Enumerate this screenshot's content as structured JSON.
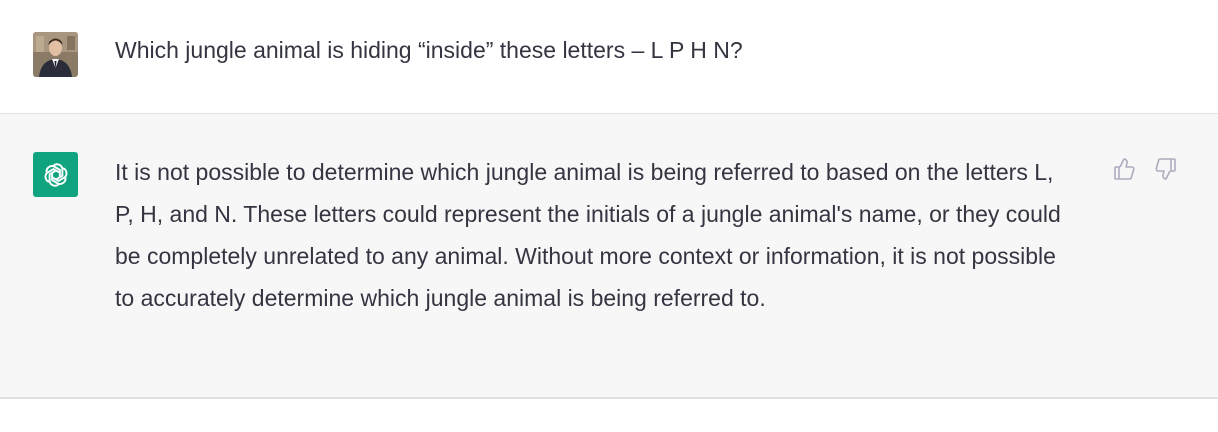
{
  "conversation": {
    "user_message": {
      "avatar_icon": "user-photo-avatar",
      "text": "Which jungle animal is hiding “inside” these letters – L P H N?"
    },
    "assistant_message": {
      "avatar_icon": "openai-logo-icon",
      "accent_color": "#10a37f",
      "text": "It is not possible to determine which jungle animal is being referred to based on the letters L, P, H, and N. These letters could represent the initials of a jungle animal's name, or they could be completely unrelated to any animal. Without more context or information, it is not possible to accurately determine which jungle animal is being referred to.",
      "feedback": {
        "thumbs_up_icon": "thumbs-up-icon",
        "thumbs_down_icon": "thumbs-down-icon"
      }
    }
  }
}
